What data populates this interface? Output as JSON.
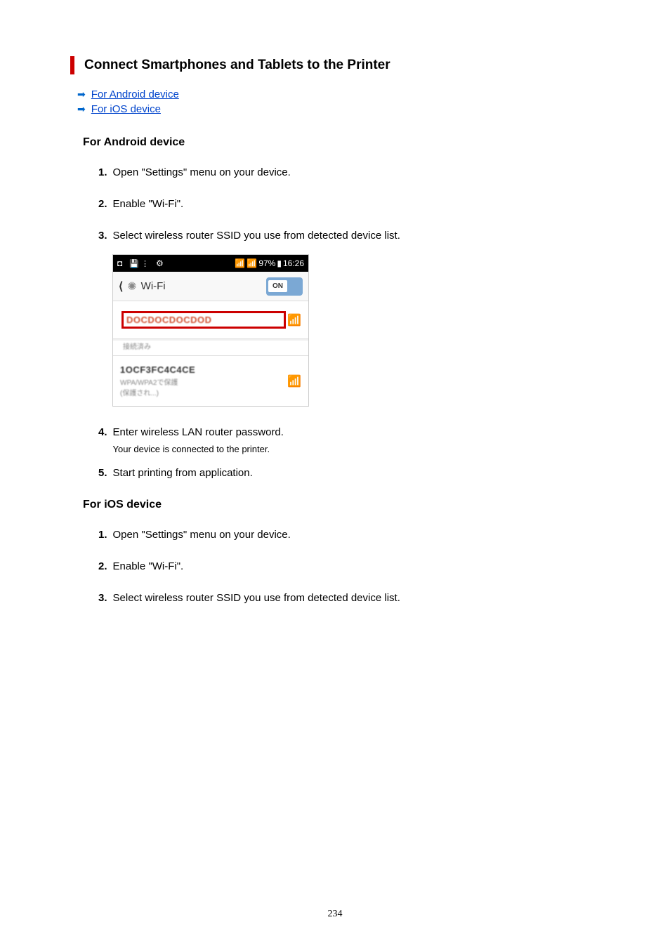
{
  "heading": "Connect Smartphones and Tablets to the Printer",
  "links": {
    "android": "For Android device",
    "ios": "For iOS device"
  },
  "sections": {
    "android": {
      "title": "For Android device",
      "steps": {
        "s1": {
          "num": "1.",
          "text": "Open \"Settings\" menu on your device."
        },
        "s2": {
          "num": "2.",
          "text": "Enable \"Wi-Fi\"."
        },
        "s3": {
          "num": "3.",
          "text": "Select wireless router SSID you use from detected device list."
        },
        "s4": {
          "num": "4.",
          "text": "Enter wireless LAN router password.",
          "sub": "Your device is connected to the printer."
        },
        "s5": {
          "num": "5.",
          "text": "Start printing from application."
        }
      }
    },
    "ios": {
      "title": "For iOS device",
      "steps": {
        "s1": {
          "num": "1.",
          "text": "Open \"Settings\" menu on your device."
        },
        "s2": {
          "num": "2.",
          "text": "Enable \"Wi-Fi\"."
        },
        "s3": {
          "num": "3.",
          "text": "Select wireless router SSID you use from detected device list."
        }
      }
    }
  },
  "screenshot": {
    "status_time": "16:26",
    "status_battery": "97%",
    "wifi_label": "Wi-Fi",
    "toggle": "ON"
  },
  "page_number": "234"
}
